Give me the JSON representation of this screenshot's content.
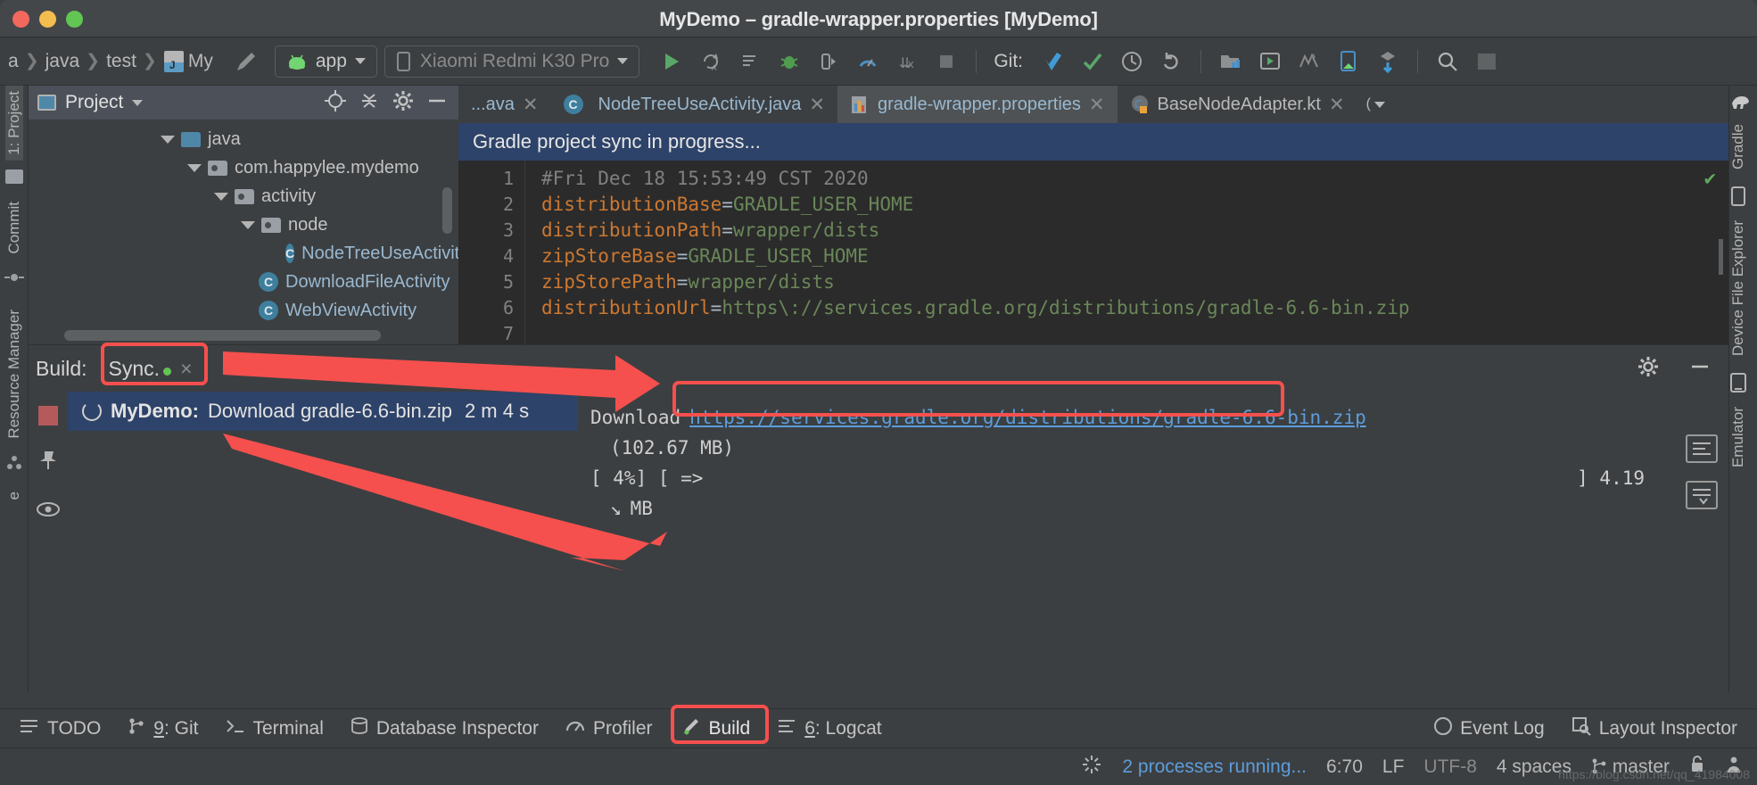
{
  "window": {
    "title": "MyDemo – gradle-wrapper.properties [MyDemo]",
    "traffic": [
      "close-button",
      "minimize-button",
      "zoom-button"
    ]
  },
  "toolbar": {
    "breadcrumbs": [
      "a",
      "java",
      "test",
      "My"
    ],
    "module_selector": "app",
    "device_selector": "Xiaomi Redmi K30 Pro",
    "git_label": "Git:",
    "icons": [
      "run-icon",
      "apply-changes-icon",
      "apply-code-changes-icon",
      "debug-icon",
      "attach-debugger-icon",
      "profiler-icon",
      "stop-stepping-icon",
      "stop-icon",
      "git-update-icon",
      "git-commit-icon",
      "history-icon",
      "undo-icon",
      "project-structure-icon",
      "avd-manager-icon",
      "sdk-manager-icon",
      "device-file-explorer-icon",
      "layout-capture-icon",
      "search-icon"
    ]
  },
  "left_rail": [
    "1: Project",
    "Commit",
    "Resource Manager"
  ],
  "right_rail": [
    "Gradle",
    "Device File Explorer",
    "Emulator"
  ],
  "project_panel": {
    "title": "Project",
    "actions": [
      "locate-icon",
      "collapse-all-icon",
      "settings-icon",
      "hide-icon"
    ],
    "tree": [
      {
        "label": "java",
        "indent": 3,
        "kind": "folder-source",
        "expanded": true
      },
      {
        "label": "com.happylee.mydemo",
        "indent": 4,
        "kind": "package",
        "expanded": true
      },
      {
        "label": "activity",
        "indent": 5,
        "kind": "package",
        "expanded": true
      },
      {
        "label": "node",
        "indent": 6,
        "kind": "package",
        "expanded": true
      },
      {
        "label": "NodeTreeUseActivity",
        "indent": 7,
        "kind": "class"
      },
      {
        "label": "DownloadFileActivity",
        "indent": 7,
        "kind": "class"
      },
      {
        "label": "WebViewActivity",
        "indent": 7,
        "kind": "class"
      }
    ]
  },
  "editor": {
    "tabs": [
      {
        "label": "...ava",
        "icon": "java-class-icon",
        "active": false,
        "closeable": true
      },
      {
        "label": "NodeTreeUseActivity.java",
        "icon": "java-class-icon",
        "active": false,
        "closeable": true
      },
      {
        "label": "gradle-wrapper.properties",
        "icon": "gradle-properties-icon",
        "active": true,
        "closeable": true
      },
      {
        "label": "BaseNodeAdapter.kt",
        "icon": "kotlin-class-icon",
        "active": false,
        "closeable": true
      }
    ],
    "banner": "Gradle project sync in progress...",
    "line_numbers": [
      1,
      2,
      3,
      4,
      5,
      6,
      7
    ],
    "lines": [
      {
        "n": 1,
        "comment": "#Fri Dec 18 15:53:49 CST 2020"
      },
      {
        "n": 2,
        "key": "distributionBase",
        "value": "GRADLE_USER_HOME"
      },
      {
        "n": 3,
        "key": "distributionPath",
        "value": "wrapper/dists"
      },
      {
        "n": 4,
        "key": "zipStoreBase",
        "value": "GRADLE_USER_HOME"
      },
      {
        "n": 5,
        "key": "zipStorePath",
        "value": "wrapper/dists"
      },
      {
        "n": 6,
        "key": "distributionUrl",
        "value": "https\\://services.gradle.org/distributions/gradle-6.6-bin.zip"
      },
      {
        "n": 7,
        "key": "",
        "value": ""
      }
    ],
    "inspection_status": "ok-check-icon"
  },
  "build_window": {
    "label": "Build:",
    "tab": "Sync.",
    "tab_close": "×",
    "actions": [
      "settings-icon",
      "hide-icon",
      "expand-icon",
      "collapse-icon"
    ],
    "task": {
      "title_bold": "MyDemo:",
      "title": " Download gradle-6.6-bin.zip",
      "duration": "2 m 4 s"
    },
    "detail": {
      "prefix": "Download",
      "url": "https://services.gradle.org/distributions/gradle-6.6-bin.zip",
      "size": "(102.67 MB)",
      "progress_left": "[   4%] [ =>",
      "progress_right": "] 4.19",
      "unit": "MB"
    }
  },
  "bottom_bar": {
    "items": [
      {
        "label": "TODO",
        "icon": "todo-icon",
        "mnemonic": ""
      },
      {
        "label": "9: Git",
        "icon": "git-icon",
        "mnemonic": "9"
      },
      {
        "label": "Terminal",
        "icon": "terminal-icon",
        "mnemonic": ""
      },
      {
        "label": "Database Inspector",
        "icon": "database-icon",
        "mnemonic": ""
      },
      {
        "label": "Profiler",
        "icon": "profiler-icon",
        "mnemonic": ""
      },
      {
        "label": "Build",
        "icon": "build-hammer-icon",
        "mnemonic": "",
        "highlighted": true
      },
      {
        "label": "6: Logcat",
        "icon": "logcat-icon",
        "mnemonic": "6"
      }
    ],
    "right_items": [
      {
        "label": "Event Log",
        "icon": "event-log-icon"
      },
      {
        "label": "Layout Inspector",
        "icon": "layout-inspector-icon"
      }
    ]
  },
  "status_bar": {
    "processes": "2 processes running...",
    "caret": "6:70",
    "line_separator": "LF",
    "encoding": "UTF-8",
    "indent": "4 spaces",
    "branch": "master",
    "icons": [
      "processes-spinner-icon",
      "lock-icon",
      "notification-icon"
    ],
    "watermark": "https://blog.csdn.net/qq_41984008"
  },
  "annotations": {
    "color": "#f5504e",
    "boxes": [
      "sync-tab-box",
      "download-url-box",
      "build-button-box"
    ],
    "arrows": [
      "arrow-to-download-url",
      "arrow-to-build-task",
      "arrow-to-build-button"
    ]
  },
  "colors": {
    "accent_blue": "#2e4369",
    "link_blue": "#5c9ddb",
    "annotation_red": "#f5504e",
    "panel_bg": "#3c3f41",
    "editor_bg": "#2b2b2b"
  }
}
